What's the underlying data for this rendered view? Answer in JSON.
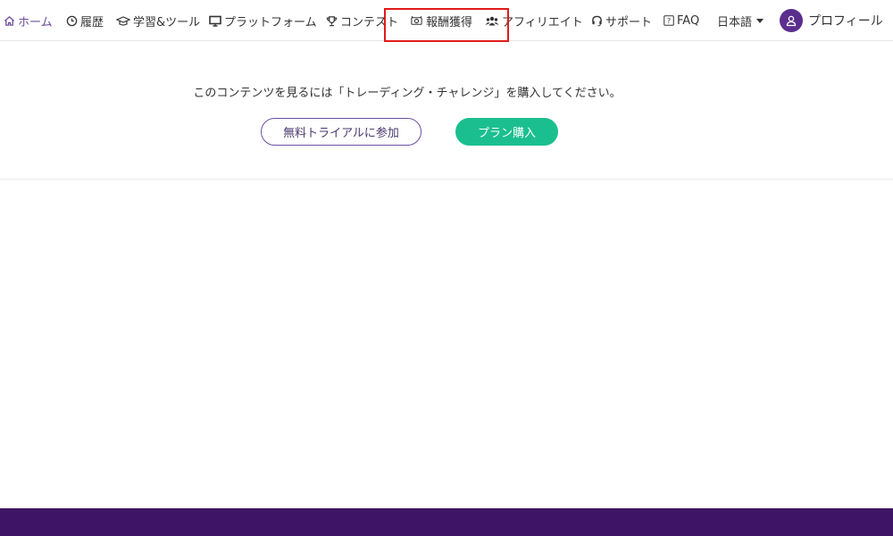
{
  "nav": {
    "home": "ホーム",
    "history": "履歴",
    "learning": "学習&ツール",
    "platform": "プラットフォーム",
    "contest": "コンテスト",
    "rewards": "報酬獲得",
    "affiliate": "アフィリエイト",
    "support": "サポート",
    "faq": "FAQ",
    "language": "日本語",
    "profile": "プロフィール"
  },
  "content": {
    "message": "このコンテンツを見るには「トレーディング・チャレンジ」を購入してください。",
    "trial_button": "無料トライアルに参加",
    "buy_button": "プラン購入"
  },
  "colors": {
    "accent": "#6b4fa0",
    "buy": "#1bbf8f",
    "footer": "#3e1466",
    "highlight": "#e21b1b"
  },
  "icons": [
    "home-icon",
    "clock-icon",
    "graduation-cap-icon",
    "monitor-icon",
    "trophy-icon",
    "rewards-icon",
    "users-icon",
    "headset-icon",
    "question-icon",
    "user-icon"
  ]
}
